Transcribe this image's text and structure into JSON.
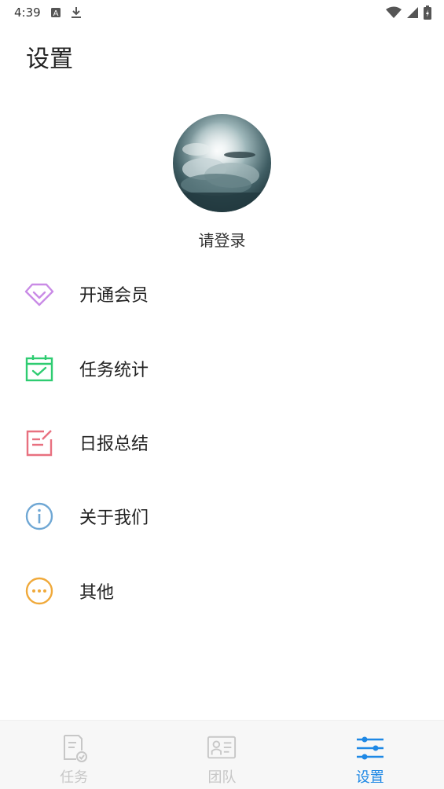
{
  "status_bar": {
    "time": "4:39",
    "icons": [
      "a-notification-icon",
      "download-icon",
      "wifi-icon",
      "signal-icon",
      "battery-icon"
    ]
  },
  "page": {
    "title": "设置"
  },
  "profile": {
    "login_text": "请登录"
  },
  "menu": {
    "items": [
      {
        "label": "开通会员",
        "icon": "diamond-icon",
        "color": "#c98be6"
      },
      {
        "label": "任务统计",
        "icon": "calendar-check-icon",
        "color": "#2ecc71"
      },
      {
        "label": "日报总结",
        "icon": "edit-note-icon",
        "color": "#e8707f"
      },
      {
        "label": "关于我们",
        "icon": "info-icon",
        "color": "#6fa7d4"
      },
      {
        "label": "其他",
        "icon": "more-icon",
        "color": "#f0a93a"
      }
    ]
  },
  "bottom_nav": {
    "tabs": [
      {
        "label": "任务",
        "icon": "task-icon",
        "active": false
      },
      {
        "label": "团队",
        "icon": "team-card-icon",
        "active": false
      },
      {
        "label": "设置",
        "icon": "sliders-icon",
        "active": true
      }
    ]
  },
  "colors": {
    "accent": "#1e88e5",
    "inactive": "#c7c7c7"
  }
}
